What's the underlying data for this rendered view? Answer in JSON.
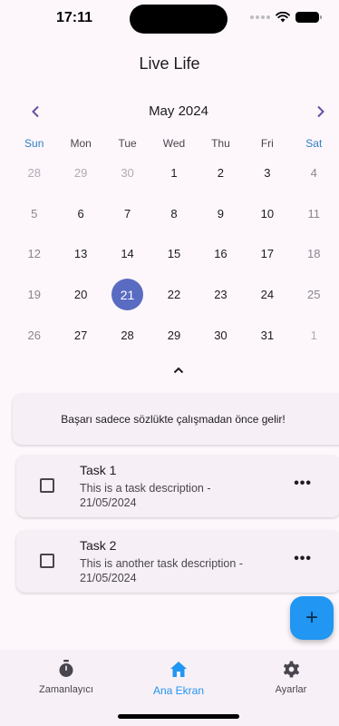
{
  "status_bar": {
    "time": "17:11"
  },
  "app": {
    "title": "Live Life"
  },
  "calendar": {
    "month": "May 2024",
    "weekdays": [
      "Sun",
      "Mon",
      "Tue",
      "Wed",
      "Thu",
      "Fri",
      "Sat"
    ],
    "weeks": [
      [
        "28",
        "29",
        "30",
        "1",
        "2",
        "3",
        "4"
      ],
      [
        "5",
        "6",
        "7",
        "8",
        "9",
        "10",
        "11"
      ],
      [
        "12",
        "13",
        "14",
        "15",
        "16",
        "17",
        "18"
      ],
      [
        "19",
        "20",
        "21",
        "22",
        "23",
        "24",
        "25"
      ],
      [
        "26",
        "27",
        "28",
        "29",
        "30",
        "31",
        "1"
      ]
    ],
    "selected_day": "21",
    "selected_color": "#5a6bc2",
    "weekend_header_color": "#2f80c4",
    "prev_icon": "chevron-left-icon",
    "next_icon": "chevron-right-icon",
    "collapse_icon": "chevron-up-icon"
  },
  "quote": {
    "text": "Başarı sadece sözlükte çalışmadan önce gelir!"
  },
  "tasks": [
    {
      "title": "Task 1",
      "description": "This is a task description - 21/05/2024",
      "checked": false
    },
    {
      "title": "Task 2",
      "description": "This is another task description - 21/05/2024",
      "checked": false
    }
  ],
  "fab": {
    "label": "+",
    "icon": "plus-icon",
    "color": "#2196f3"
  },
  "bottom_nav": {
    "items": [
      {
        "label": "Zamanlayıcı",
        "icon": "timer-icon",
        "active": false
      },
      {
        "label": "Ana Ekran",
        "icon": "home-icon",
        "active": true
      },
      {
        "label": "Ayarlar",
        "icon": "gear-icon",
        "active": false
      }
    ],
    "active_color": "#2196f3"
  }
}
